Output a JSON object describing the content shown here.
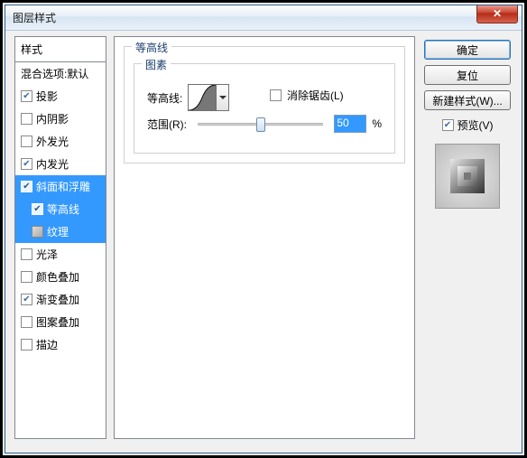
{
  "window": {
    "title": "图层样式",
    "close": "✕"
  },
  "left": {
    "header": "样式",
    "blend": "混合选项:默认",
    "items": [
      {
        "label": "投影",
        "checked": true
      },
      {
        "label": "内阴影",
        "checked": false
      },
      {
        "label": "外发光",
        "checked": false
      },
      {
        "label": "内发光",
        "checked": true
      },
      {
        "label": "斜面和浮雕",
        "checked": true,
        "selected": true
      },
      {
        "label": "等高线",
        "checked": true,
        "sub": true,
        "selected": true
      },
      {
        "label": "纹理",
        "checked": false,
        "sub": true,
        "selected": true,
        "texicon": true
      },
      {
        "label": "光泽",
        "checked": false
      },
      {
        "label": "颜色叠加",
        "checked": false
      },
      {
        "label": "渐变叠加",
        "checked": true
      },
      {
        "label": "图案叠加",
        "checked": false
      },
      {
        "label": "描边",
        "checked": false
      }
    ]
  },
  "mid": {
    "group_outer": "等高线",
    "group_inner": "图素",
    "contour_label": "等高线:",
    "antialias": "消除锯齿(L)",
    "antialias_checked": false,
    "range_label": "范围(R):",
    "range_value": "50",
    "range_unit": "%"
  },
  "right": {
    "ok": "确定",
    "cancel": "复位",
    "newstyle": "新建样式(W)...",
    "preview_label": "预览(V)",
    "preview_checked": true
  }
}
